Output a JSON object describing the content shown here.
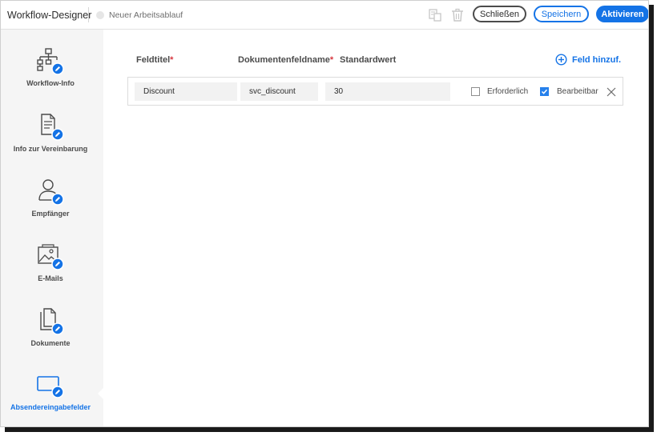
{
  "header": {
    "app_title": "Workflow-Designer",
    "status": "Neuer Arbeitsablauf",
    "buttons": {
      "close": "Schließen",
      "save": "Speichern",
      "activate": "Aktivieren"
    }
  },
  "sidebar": {
    "items": [
      {
        "label": "Workflow-Info",
        "icon": "workflow-icon"
      },
      {
        "label": "Info zur Vereinbarung",
        "icon": "document-info-icon"
      },
      {
        "label": "Empfänger",
        "icon": "recipient-icon"
      },
      {
        "label": "E-Mails",
        "icon": "email-icon"
      },
      {
        "label": "Dokumente",
        "icon": "documents-icon"
      },
      {
        "label": "Absendereingabefelder",
        "icon": "sender-fields-icon",
        "active": true
      }
    ]
  },
  "main": {
    "columns": {
      "field_title": "Feldtitel",
      "doc_field_name": "Dokumentenfeldname",
      "default_value": "Standardwert",
      "required_mark": "*"
    },
    "add_field": "Feld hinzuf.",
    "rows": [
      {
        "field_title": "Discount",
        "doc_field_name": "svc_discount",
        "default_value": "30",
        "required_label": "Erforderlich",
        "required": false,
        "editable_label": "Bearbeitbar",
        "editable": true
      }
    ]
  },
  "colors": {
    "accent": "#1473e6",
    "sidebar_bg": "#f5f5f5",
    "required_star": "#d7373f"
  }
}
